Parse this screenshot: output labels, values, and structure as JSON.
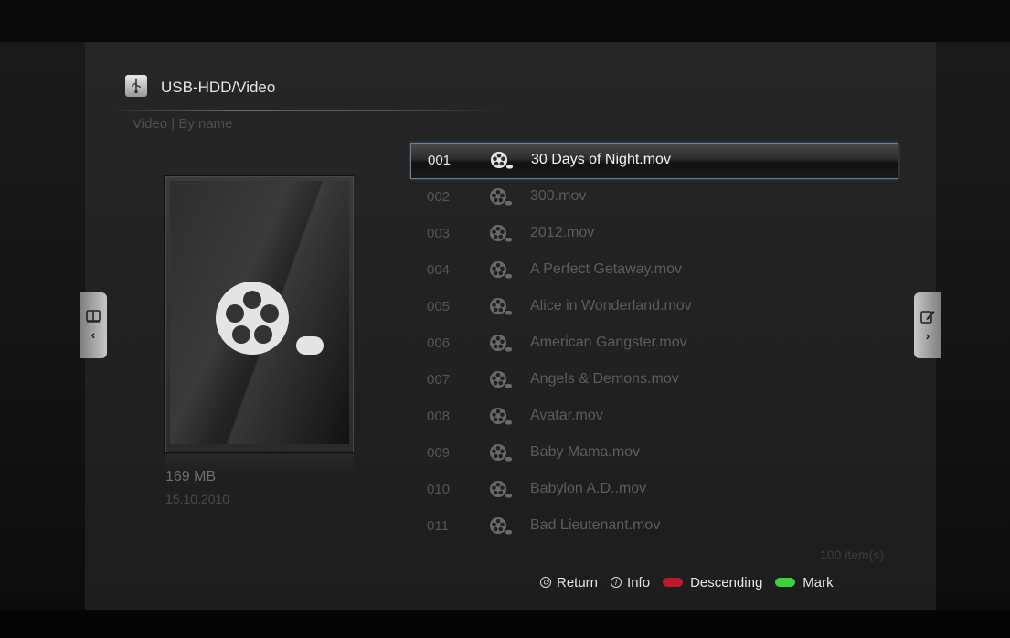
{
  "header": {
    "title": "USB-HDD/Video",
    "icon": "usb-icon",
    "subheader": "Video | By name"
  },
  "preview": {
    "file_size": "169 MB",
    "file_date": "15.10.2010",
    "icon": "film-reel-icon"
  },
  "files": [
    {
      "num": "001",
      "name": "30 Days of Night.mov",
      "selected": true
    },
    {
      "num": "002",
      "name": "300.mov"
    },
    {
      "num": "003",
      "name": "2012.mov"
    },
    {
      "num": "004",
      "name": "A Perfect Getaway.mov"
    },
    {
      "num": "005",
      "name": "Alice in Wonderland.mov"
    },
    {
      "num": "006",
      "name": "American Gangster.mov"
    },
    {
      "num": "007",
      "name": "Angels & Demons.mov"
    },
    {
      "num": "008",
      "name": "Avatar.mov"
    },
    {
      "num": "009",
      "name": "Baby Mama.mov"
    },
    {
      "num": "010",
      "name": "Babylon A.D..mov"
    },
    {
      "num": "011",
      "name": "Bad Lieutenant.mov"
    }
  ],
  "item_count": "100 item(s)",
  "legend": {
    "return_label": "Return",
    "info_label": "Info",
    "descending_label": "Descending",
    "mark_label": "Mark",
    "red_color": "#c0182a",
    "green_color": "#3ad43a"
  },
  "side_tabs": {
    "left_icon": "book-icon",
    "right_icon": "edit-icon"
  }
}
